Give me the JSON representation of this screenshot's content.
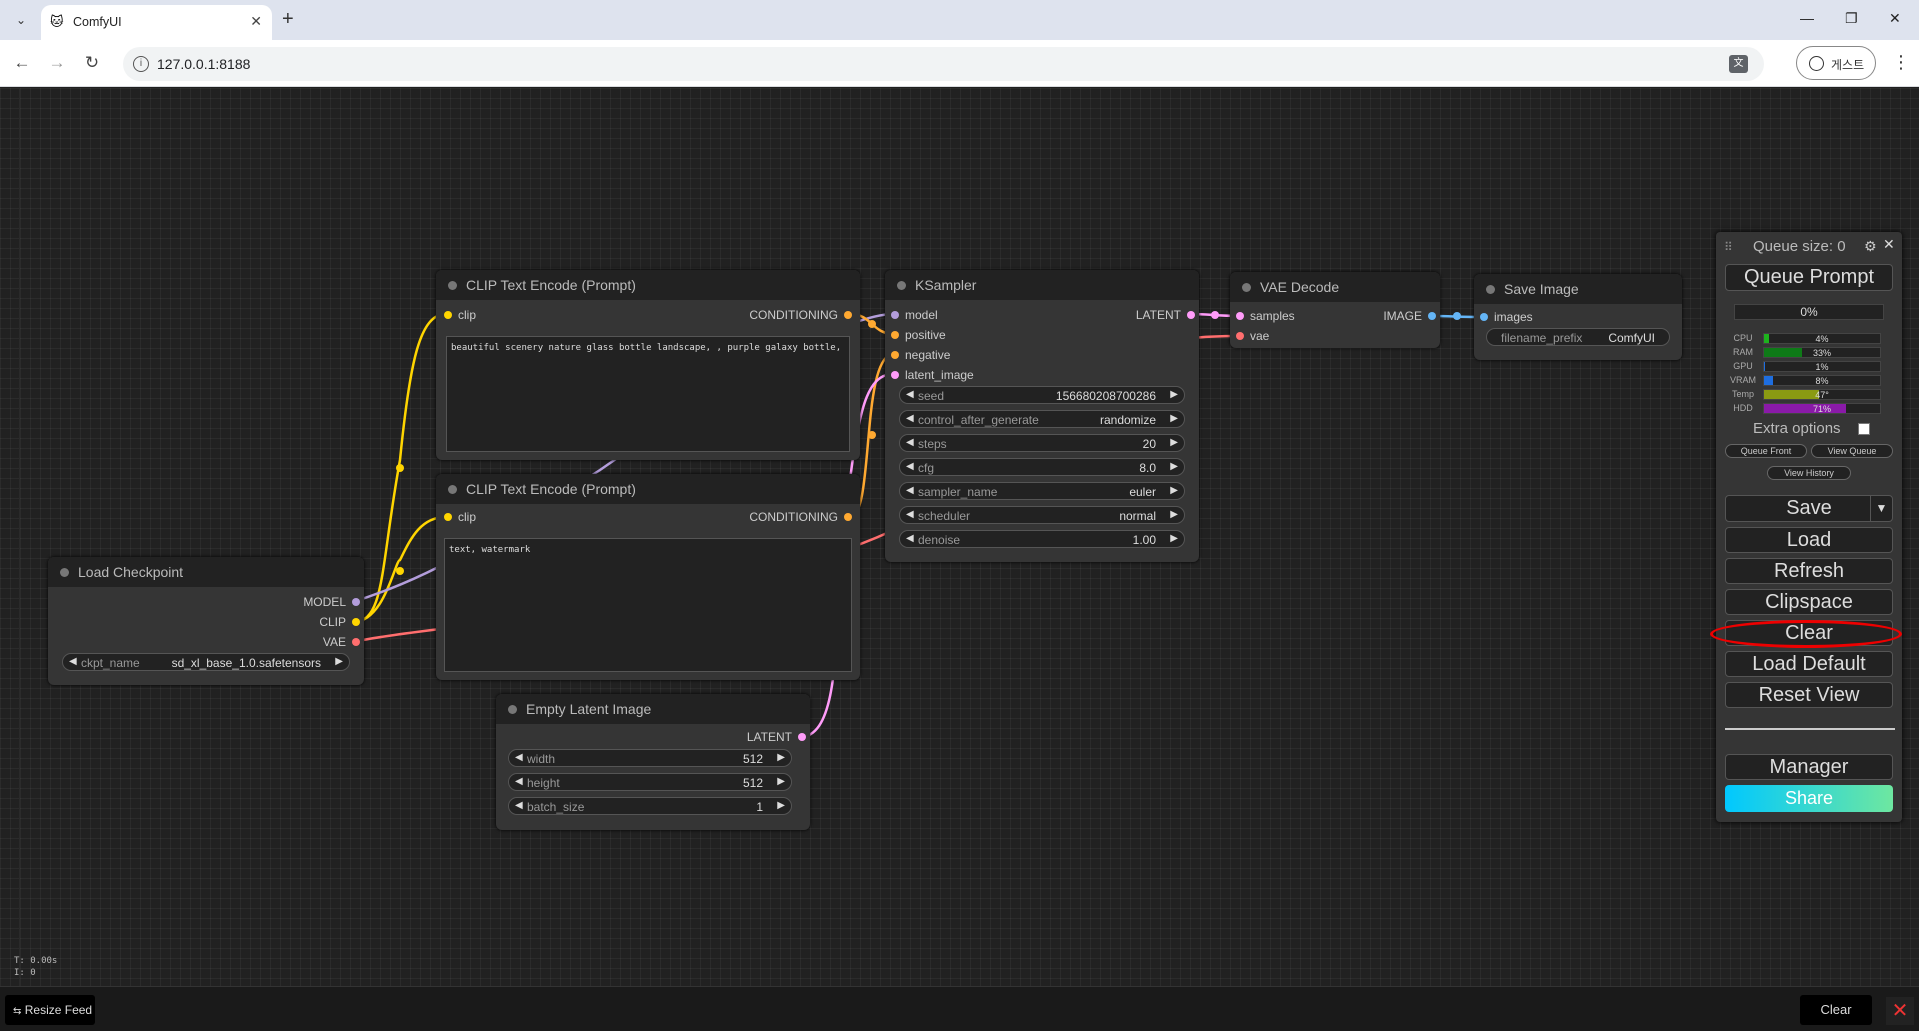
{
  "browser": {
    "tab_title": "ComfyUI",
    "url": "127.0.0.1:8188",
    "profile_label": "게스트"
  },
  "nodes": {
    "clip_pos": {
      "title": "CLIP Text Encode (Prompt)",
      "input": "clip",
      "output": "CONDITIONING",
      "text": "beautiful scenery nature glass bottle landscape, , purple galaxy bottle,"
    },
    "clip_neg": {
      "title": "CLIP Text Encode (Prompt)",
      "input": "clip",
      "output": "CONDITIONING",
      "text": "text, watermark"
    },
    "ksampler": {
      "title": "KSampler",
      "inputs": [
        "model",
        "positive",
        "negative",
        "latent_image"
      ],
      "output": "LATENT",
      "widgets": [
        {
          "label": "seed",
          "value": "156680208700286"
        },
        {
          "label": "control_after_generate",
          "value": "randomize"
        },
        {
          "label": "steps",
          "value": "20"
        },
        {
          "label": "cfg",
          "value": "8.0"
        },
        {
          "label": "sampler_name",
          "value": "euler"
        },
        {
          "label": "scheduler",
          "value": "normal"
        },
        {
          "label": "denoise",
          "value": "1.00"
        }
      ]
    },
    "vae_decode": {
      "title": "VAE Decode",
      "inputs": [
        "samples",
        "vae"
      ],
      "output": "IMAGE"
    },
    "save_image": {
      "title": "Save Image",
      "input": "images",
      "widget": {
        "label": "filename_prefix",
        "value": "ComfyUI"
      }
    },
    "load_checkpoint": {
      "title": "Load Checkpoint",
      "outputs": [
        "MODEL",
        "CLIP",
        "VAE"
      ],
      "widget": {
        "label": "ckpt_name",
        "value": "sd_xl_base_1.0.safetensors"
      }
    },
    "empty_latent": {
      "title": "Empty Latent Image",
      "output": "LATENT",
      "widgets": [
        {
          "label": "width",
          "value": "512"
        },
        {
          "label": "height",
          "value": "512"
        },
        {
          "label": "batch_size",
          "value": "1"
        }
      ]
    }
  },
  "queue": {
    "size_label": "Queue size: 0",
    "queue_prompt": "Queue Prompt",
    "progress": "0%",
    "stats": [
      {
        "label": "CPU",
        "value": "4%",
        "fraction": 0.04,
        "color": "#1db31d"
      },
      {
        "label": "RAM",
        "value": "33%",
        "fraction": 0.33,
        "color": "#0e7a17"
      },
      {
        "label": "GPU",
        "value": "1%",
        "fraction": 0.01,
        "color": "#1e6ee0"
      },
      {
        "label": "VRAM",
        "value": "8%",
        "fraction": 0.08,
        "color": "#1e6ee0"
      },
      {
        "label": "Temp",
        "value": "47°",
        "fraction": 0.47,
        "color": "#8a9a12"
      },
      {
        "label": "HDD",
        "value": "71%",
        "fraction": 0.71,
        "color": "#8a1aa8"
      }
    ],
    "extra_options": "Extra options",
    "queue_front": "Queue Front",
    "view_queue": "View Queue",
    "view_history": "View History",
    "buttons": {
      "save": "Save",
      "load": "Load",
      "refresh": "Refresh",
      "clipspace": "Clipspace",
      "clear": "Clear",
      "load_default": "Load Default",
      "reset_view": "Reset View",
      "manager": "Manager",
      "share": "Share"
    }
  },
  "canvas_stats": {
    "time": "T: 0.00s",
    "nodes": "I: 0"
  },
  "bottom": {
    "resize_feed": "Resize Feed",
    "clear": "Clear"
  }
}
